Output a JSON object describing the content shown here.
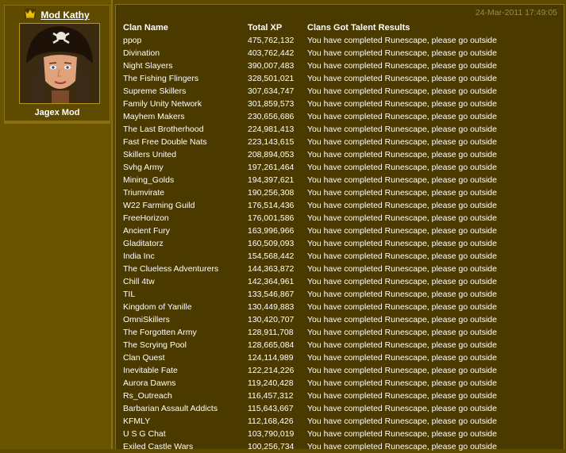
{
  "sidebar": {
    "user": {
      "name": "Mod Kathy",
      "role": "Jagex Mod",
      "crown_icon": "crown-icon"
    }
  },
  "post": {
    "timestamp": "24-Mar-2011 17:49:05",
    "table": {
      "headers": [
        "Clan Name",
        "Total XP",
        "Clans Got Talent Results"
      ],
      "rows": [
        [
          "ppop",
          "475,762,132",
          "You have completed Runescape, please go outside"
        ],
        [
          "Divination",
          "403,762,442",
          "You have completed Runescape, please go outside"
        ],
        [
          "Night Slayers",
          "390,007,483",
          "You have completed Runescape, please go outside"
        ],
        [
          "The Fishing Flingers",
          "328,501,021",
          "You have completed Runescape, please go outside"
        ],
        [
          "Supreme Skillers",
          "307,634,747",
          "You have completed Runescape, please go outside"
        ],
        [
          "Family Unity Network",
          "301,859,573",
          "You have completed Runescape, please go outside"
        ],
        [
          "Mayhem Makers",
          "230,656,686",
          "You have completed Runescape, please go outside"
        ],
        [
          "The Last Brotherhood",
          "224,981,413",
          "You have completed Runescape, please go outside"
        ],
        [
          "Fast Free Double Nats",
          "223,143,615",
          "You have completed Runescape, please go outside"
        ],
        [
          "Skillers United",
          "208,894,053",
          "You have completed Runescape, please go outside"
        ],
        [
          "Svhg Army",
          "197,261,464",
          "You have completed Runescape, please go outside"
        ],
        [
          "Mining_Golds",
          "194,397,621",
          "You have completed Runescape, please go outside"
        ],
        [
          "Triumvirate",
          "190,256,308",
          "You have completed Runescape, please go outside"
        ],
        [
          "W22 Farming Guild",
          "176,514,436",
          "You have completed Runescape, please go outside"
        ],
        [
          "FreeHorizon",
          "176,001,586",
          "You have completed Runescape, please go outside"
        ],
        [
          "Ancient Fury",
          "163,996,966",
          "You have completed Runescape, please go outside"
        ],
        [
          "Gladitatorz",
          "160,509,093",
          "You have completed Runescape, please go outside"
        ],
        [
          "India Inc",
          "154,568,442",
          "You have completed Runescape, please go outside"
        ],
        [
          "The Clueless Adventurers",
          "144,363,872",
          "You have completed Runescape, please go outside"
        ],
        [
          "Chill 4tw",
          "142,364,961",
          "You have completed Runescape, please go outside"
        ],
        [
          "TIL",
          "133,546,867",
          "You have completed Runescape, please go outside"
        ],
        [
          "Kingdom of Yanille",
          "130,449,883",
          "You have completed Runescape, please go outside"
        ],
        [
          "OmniSkillers",
          "130,420,707",
          "You have completed Runescape, please go outside"
        ],
        [
          "The Forgotten Army",
          "128,911,708",
          "You have completed Runescape, please go outside"
        ],
        [
          "The Scrying Pool",
          "128,665,084",
          "You have completed Runescape, please go outside"
        ],
        [
          "Clan Quest",
          "124,114,989",
          "You have completed Runescape, please go outside"
        ],
        [
          "Inevitable Fate",
          "122,214,226",
          "You have completed Runescape, please go outside"
        ],
        [
          "Aurora Dawns",
          "119,240,428",
          "You have completed Runescape, please go outside"
        ],
        [
          "Rs_Outreach",
          "116,457,312",
          "You have completed Runescape, please go outside"
        ],
        [
          "Barbarian Assault Addicts",
          "115,643,667",
          "You have completed Runescape, please go outside"
        ],
        [
          "KFMLY",
          "112,168,426",
          "You have completed Runescape, please go outside"
        ],
        [
          "U S G Chat",
          "103,790,019",
          "You have completed Runescape, please go outside"
        ],
        [
          "Exiled Castle Wars",
          "100,256,734",
          "You have completed Runescape, please go outside"
        ]
      ]
    }
  }
}
